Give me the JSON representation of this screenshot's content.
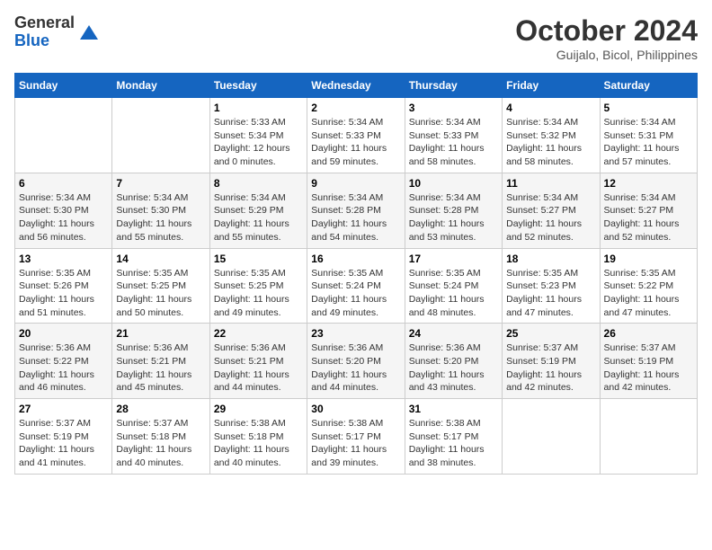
{
  "logo": {
    "general": "General",
    "blue": "Blue"
  },
  "title": {
    "month_year": "October 2024",
    "location": "Guijalo, Bicol, Philippines"
  },
  "weekdays": [
    "Sunday",
    "Monday",
    "Tuesday",
    "Wednesday",
    "Thursday",
    "Friday",
    "Saturday"
  ],
  "weeks": [
    [
      {
        "day": null,
        "info": null
      },
      {
        "day": null,
        "info": null
      },
      {
        "day": "1",
        "info": "Sunrise: 5:33 AM\nSunset: 5:34 PM\nDaylight: 12 hours\nand 0 minutes."
      },
      {
        "day": "2",
        "info": "Sunrise: 5:34 AM\nSunset: 5:33 PM\nDaylight: 11 hours\nand 59 minutes."
      },
      {
        "day": "3",
        "info": "Sunrise: 5:34 AM\nSunset: 5:33 PM\nDaylight: 11 hours\nand 58 minutes."
      },
      {
        "day": "4",
        "info": "Sunrise: 5:34 AM\nSunset: 5:32 PM\nDaylight: 11 hours\nand 58 minutes."
      },
      {
        "day": "5",
        "info": "Sunrise: 5:34 AM\nSunset: 5:31 PM\nDaylight: 11 hours\nand 57 minutes."
      }
    ],
    [
      {
        "day": "6",
        "info": "Sunrise: 5:34 AM\nSunset: 5:30 PM\nDaylight: 11 hours\nand 56 minutes."
      },
      {
        "day": "7",
        "info": "Sunrise: 5:34 AM\nSunset: 5:30 PM\nDaylight: 11 hours\nand 55 minutes."
      },
      {
        "day": "8",
        "info": "Sunrise: 5:34 AM\nSunset: 5:29 PM\nDaylight: 11 hours\nand 55 minutes."
      },
      {
        "day": "9",
        "info": "Sunrise: 5:34 AM\nSunset: 5:28 PM\nDaylight: 11 hours\nand 54 minutes."
      },
      {
        "day": "10",
        "info": "Sunrise: 5:34 AM\nSunset: 5:28 PM\nDaylight: 11 hours\nand 53 minutes."
      },
      {
        "day": "11",
        "info": "Sunrise: 5:34 AM\nSunset: 5:27 PM\nDaylight: 11 hours\nand 52 minutes."
      },
      {
        "day": "12",
        "info": "Sunrise: 5:34 AM\nSunset: 5:27 PM\nDaylight: 11 hours\nand 52 minutes."
      }
    ],
    [
      {
        "day": "13",
        "info": "Sunrise: 5:35 AM\nSunset: 5:26 PM\nDaylight: 11 hours\nand 51 minutes."
      },
      {
        "day": "14",
        "info": "Sunrise: 5:35 AM\nSunset: 5:25 PM\nDaylight: 11 hours\nand 50 minutes."
      },
      {
        "day": "15",
        "info": "Sunrise: 5:35 AM\nSunset: 5:25 PM\nDaylight: 11 hours\nand 49 minutes."
      },
      {
        "day": "16",
        "info": "Sunrise: 5:35 AM\nSunset: 5:24 PM\nDaylight: 11 hours\nand 49 minutes."
      },
      {
        "day": "17",
        "info": "Sunrise: 5:35 AM\nSunset: 5:24 PM\nDaylight: 11 hours\nand 48 minutes."
      },
      {
        "day": "18",
        "info": "Sunrise: 5:35 AM\nSunset: 5:23 PM\nDaylight: 11 hours\nand 47 minutes."
      },
      {
        "day": "19",
        "info": "Sunrise: 5:35 AM\nSunset: 5:22 PM\nDaylight: 11 hours\nand 47 minutes."
      }
    ],
    [
      {
        "day": "20",
        "info": "Sunrise: 5:36 AM\nSunset: 5:22 PM\nDaylight: 11 hours\nand 46 minutes."
      },
      {
        "day": "21",
        "info": "Sunrise: 5:36 AM\nSunset: 5:21 PM\nDaylight: 11 hours\nand 45 minutes."
      },
      {
        "day": "22",
        "info": "Sunrise: 5:36 AM\nSunset: 5:21 PM\nDaylight: 11 hours\nand 44 minutes."
      },
      {
        "day": "23",
        "info": "Sunrise: 5:36 AM\nSunset: 5:20 PM\nDaylight: 11 hours\nand 44 minutes."
      },
      {
        "day": "24",
        "info": "Sunrise: 5:36 AM\nSunset: 5:20 PM\nDaylight: 11 hours\nand 43 minutes."
      },
      {
        "day": "25",
        "info": "Sunrise: 5:37 AM\nSunset: 5:19 PM\nDaylight: 11 hours\nand 42 minutes."
      },
      {
        "day": "26",
        "info": "Sunrise: 5:37 AM\nSunset: 5:19 PM\nDaylight: 11 hours\nand 42 minutes."
      }
    ],
    [
      {
        "day": "27",
        "info": "Sunrise: 5:37 AM\nSunset: 5:19 PM\nDaylight: 11 hours\nand 41 minutes."
      },
      {
        "day": "28",
        "info": "Sunrise: 5:37 AM\nSunset: 5:18 PM\nDaylight: 11 hours\nand 40 minutes."
      },
      {
        "day": "29",
        "info": "Sunrise: 5:38 AM\nSunset: 5:18 PM\nDaylight: 11 hours\nand 40 minutes."
      },
      {
        "day": "30",
        "info": "Sunrise: 5:38 AM\nSunset: 5:17 PM\nDaylight: 11 hours\nand 39 minutes."
      },
      {
        "day": "31",
        "info": "Sunrise: 5:38 AM\nSunset: 5:17 PM\nDaylight: 11 hours\nand 38 minutes."
      },
      {
        "day": null,
        "info": null
      },
      {
        "day": null,
        "info": null
      }
    ]
  ]
}
